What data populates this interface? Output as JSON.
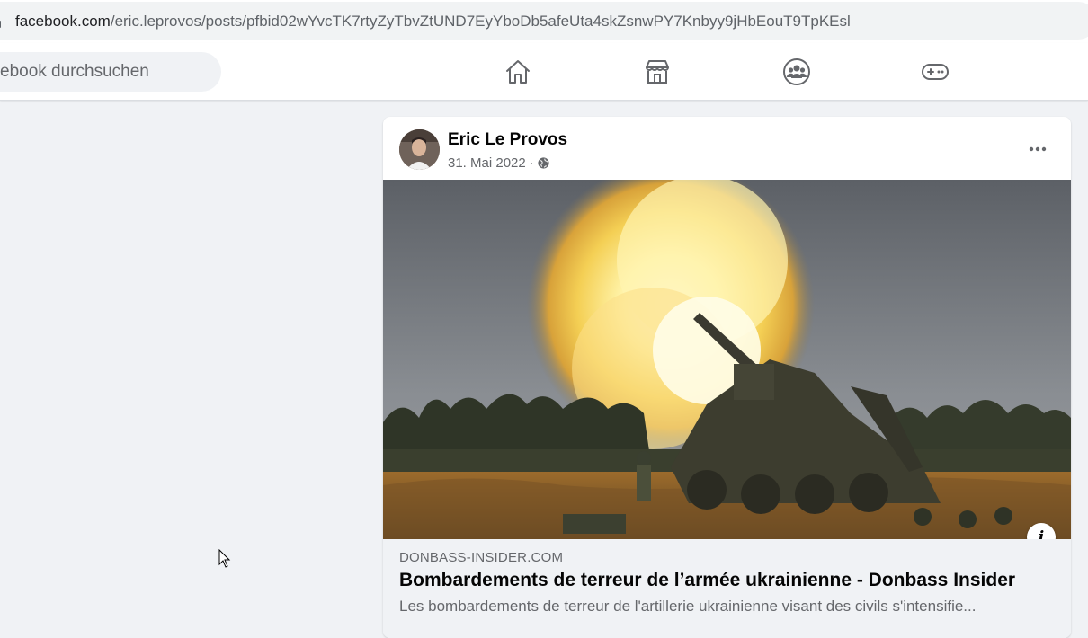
{
  "browser": {
    "url_domain": "facebook.com",
    "url_path": "/eric.leprovos/posts/pfbid02wYvcTK7rtyZyTbvZtUND7EyYboDb5afeUta4skZsnwPY7Knbyy9jHbEouT9TpKEsl"
  },
  "nav": {
    "search_placeholder": "ebook durchsuchen",
    "icons": [
      "home-icon",
      "marketplace-icon",
      "groups-icon",
      "gaming-icon"
    ]
  },
  "post": {
    "author": "Eric Le Provos",
    "date": "31. Mai 2022",
    "separator": "·",
    "privacy_icon": "globe-icon",
    "more_label": "•••",
    "info_label": "i",
    "link": {
      "domain": "DONBASS-INSIDER.COM",
      "title": "Bombardements de terreur de l’armée ukrainienne - Donbass Insider",
      "description": "Les bombardements de terreur de l'artillerie ukrainienne visant des civils s'intensifie..."
    }
  },
  "colors": {
    "background": "#f0f2f5",
    "card": "#ffffff",
    "text_primary": "#050505",
    "text_secondary": "#65676b"
  }
}
